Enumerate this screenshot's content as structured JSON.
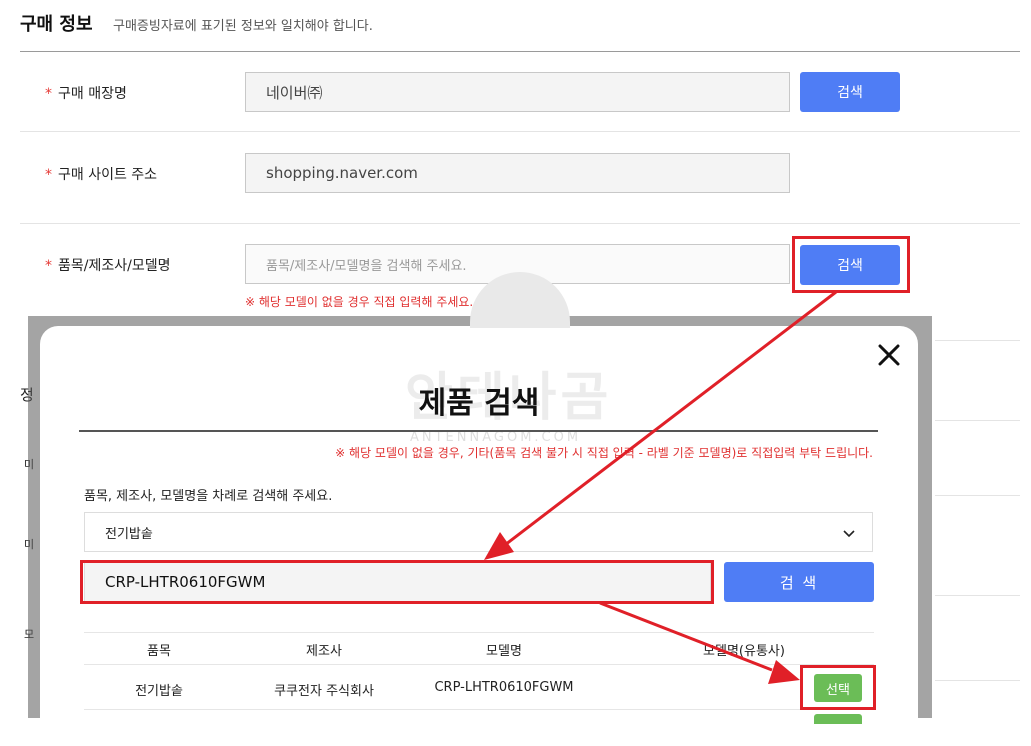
{
  "header": {
    "title": "구매 정보",
    "subtitle": "구매증빙자료에 표기된 정보와 일치해야 합니다."
  },
  "form": {
    "store": {
      "label": "구매 매장명",
      "value": "네이버㈜",
      "button": "검색"
    },
    "site": {
      "label": "구매 사이트 주소",
      "value": "shopping.naver.com"
    },
    "product": {
      "label": "품목/제조사/모델명",
      "placeholder": "품목/제조사/모델명을 검색해 주세요.",
      "button": "검색",
      "warning": "※ 해당 모델이 없을 경우 직접 입력해 주세요."
    },
    "required_mark": "*"
  },
  "side_fragments": [
    "정",
    "미",
    "미",
    "모"
  ],
  "watermark": {
    "main": "안테나곰",
    "sub": "ANTENNAGOM.COM"
  },
  "modal": {
    "title": "제품 검색",
    "warning": "※ 해당 모델이 없을 경우, 기타(품목 검색 불가 시 직접 입력 - 라벨 기준 모델명)로 직접입력 부탁 드립니다.",
    "guide": "품목, 제조사, 모델명을 차례로 검색해 주세요.",
    "category_selected": "전기밥솥",
    "model_value": "CRP-LHTR0610FGWM",
    "search_button": "검 색",
    "table": {
      "headers": [
        "품목",
        "제조사",
        "모델명",
        "모델명(유통사)"
      ],
      "rows": [
        {
          "category": "전기밥솥",
          "maker": "쿠쿠전자 주식회사",
          "model": "CRP-LHTR0610FGWM",
          "select": "선택"
        }
      ]
    }
  },
  "colors": {
    "accent_blue": "#4f7df5",
    "select_green": "#6bbd57",
    "highlight_red": "#e02028",
    "required_red": "#e53935"
  }
}
